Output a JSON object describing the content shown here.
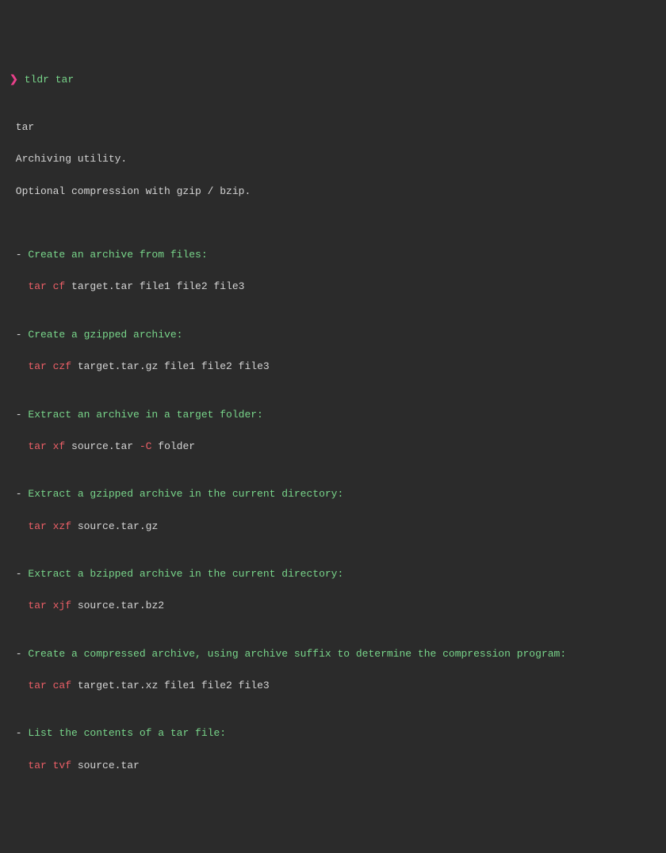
{
  "prompt": {
    "symbol": "❯",
    "command": "tldr tar"
  },
  "header": {
    "name": "tar",
    "desc1": "Archiving utility.",
    "desc2": "Optional compression with gzip / bzip."
  },
  "examples": [
    {
      "desc": "Create an archive from files:",
      "cmd": "tar",
      "flags": "cf",
      "args": "target.tar file1 file2 file3",
      "midflag": "",
      "postargs": ""
    },
    {
      "desc": "Create a gzipped archive:",
      "cmd": "tar",
      "flags": "czf",
      "args": "target.tar.gz file1 file2 file3",
      "midflag": "",
      "postargs": ""
    },
    {
      "desc": "Extract an archive in a target folder:",
      "cmd": "tar",
      "flags": "xf",
      "args": "source.tar ",
      "midflag": "-C",
      "postargs": " folder"
    },
    {
      "desc": "Extract a gzipped archive in the current directory:",
      "cmd": "tar",
      "flags": "xzf",
      "args": "source.tar.gz",
      "midflag": "",
      "postargs": ""
    },
    {
      "desc": "Extract a bzipped archive in the current directory:",
      "cmd": "tar",
      "flags": "xjf",
      "args": "source.tar.bz2",
      "midflag": "",
      "postargs": ""
    },
    {
      "desc": "Create a compressed archive, using archive suffix to determine the compression program:",
      "cmd": "tar",
      "flags": "caf",
      "args": "target.tar.xz file1 file2 file3",
      "midflag": "",
      "postargs": ""
    },
    {
      "desc": "List the contents of a tar file:",
      "cmd": "tar",
      "flags": "tvf",
      "args": "source.tar",
      "midflag": "",
      "postargs": ""
    }
  ]
}
